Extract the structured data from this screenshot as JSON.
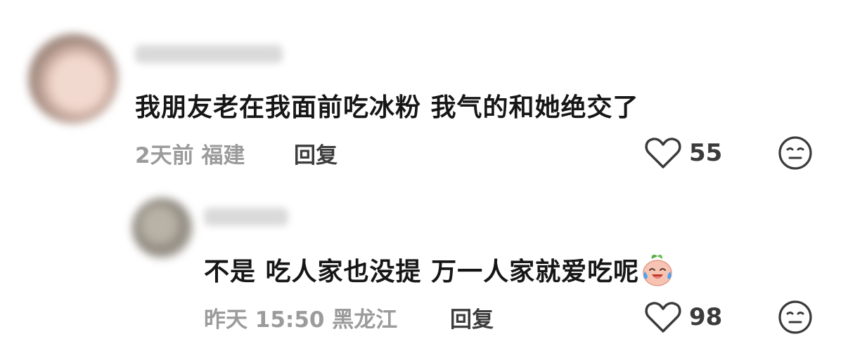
{
  "comments": [
    {
      "text": "我朋友老在我面前吃冰粉 我气的和她绝交了",
      "time": "2天前",
      "location": "福建",
      "reply_label": "回复",
      "likes": "55",
      "like_icon": "heart-outline-icon",
      "dislike_icon": "neutral-face-icon"
    },
    {
      "text": "不是 吃人家也没提 万一人家就爱吃呢",
      "time": "昨天 15:50",
      "location": "黑龙江",
      "reply_label": "回复",
      "likes": "98",
      "like_icon": "heart-outline-icon",
      "dislike_icon": "neutral-face-icon",
      "emoji": "crying-laughing-peach-emoji"
    }
  ]
}
